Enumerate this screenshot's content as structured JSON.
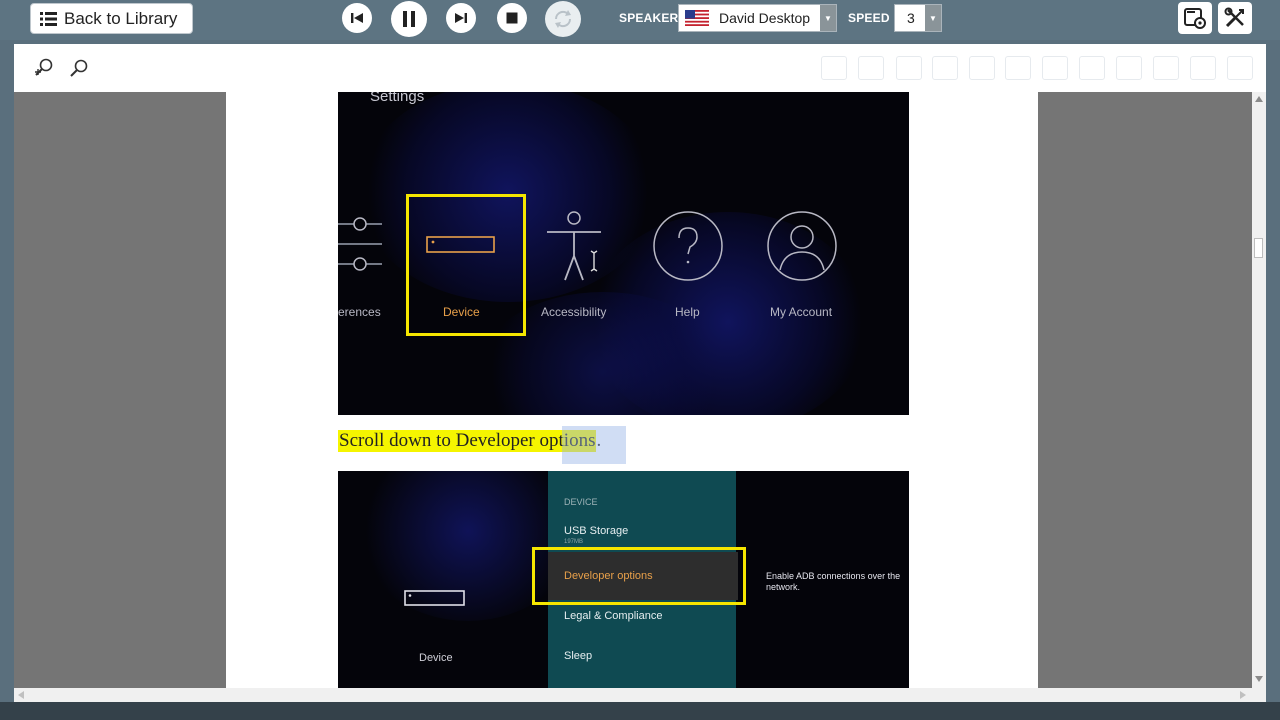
{
  "toolbar": {
    "back_label": "Back to Library",
    "speaker_label": "SPEAKER",
    "speaker_value": "David Desktop",
    "speed_label": "SPEED",
    "speed_value": "3"
  },
  "screenshot1": {
    "title": "Settings",
    "tiles": [
      "erences",
      "Device",
      "Accessibility",
      "Help",
      "My Account"
    ]
  },
  "caption": {
    "text": "Scroll down to Developer options",
    "period": "."
  },
  "screenshot2": {
    "device_label": "Device",
    "section_header": "DEVICE",
    "items": [
      "USB Storage",
      "Developer options",
      "Legal & Compliance",
      "Sleep"
    ],
    "usb_subtext": "197MB",
    "description": "Enable ADB connections over the network."
  },
  "colors": {
    "highlight": "#f5f500",
    "selected_tile": "#f5e600",
    "device_accent": "#e8a04a",
    "toolbar_bg": "#5d7482"
  }
}
